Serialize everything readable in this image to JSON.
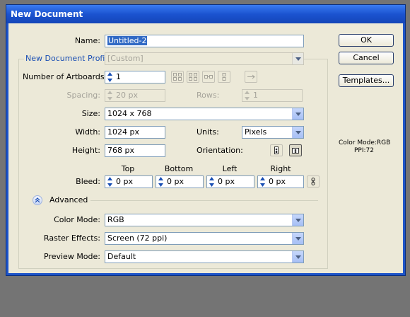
{
  "dialog": {
    "title": "New Document",
    "name_label": "Name:",
    "name_value": "Untitled-2",
    "profile_label": "New Document Profile:",
    "profile_value": "[Custom]",
    "artboards_label": "Number of Artboards:",
    "artboards_value": "1",
    "spacing_label": "Spacing:",
    "spacing_value": "20 px",
    "rows_label": "Rows:",
    "rows_value": "1",
    "size_label": "Size:",
    "size_value": "1024 x 768",
    "width_label": "Width:",
    "width_value": "1024 px",
    "units_label": "Units:",
    "units_value": "Pixels",
    "height_label": "Height:",
    "height_value": "768 px",
    "orientation_label": "Orientation:",
    "bleed_label": "Bleed:",
    "bleed": {
      "top_label": "Top",
      "top_value": "0 px",
      "bottom_label": "Bottom",
      "bottom_value": "0 px",
      "left_label": "Left",
      "left_value": "0 px",
      "right_label": "Right",
      "right_value": "0 px"
    },
    "advanced_label": "Advanced",
    "color_mode_label": "Color Mode:",
    "color_mode_value": "RGB",
    "raster_label": "Raster Effects:",
    "raster_value": "Screen (72 ppi)",
    "preview_label": "Preview Mode:",
    "preview_value": "Default"
  },
  "buttons": {
    "ok": "OK",
    "cancel": "Cancel",
    "templates": "Templates..."
  },
  "info": {
    "color_mode": "Color Mode:RGB",
    "ppi": "PPI:72"
  },
  "colors": {
    "titlebar": "#1b53d0",
    "dialog_bg": "#ece9d8",
    "backdrop": "#747474",
    "link_blue": "#1a4fb4"
  }
}
